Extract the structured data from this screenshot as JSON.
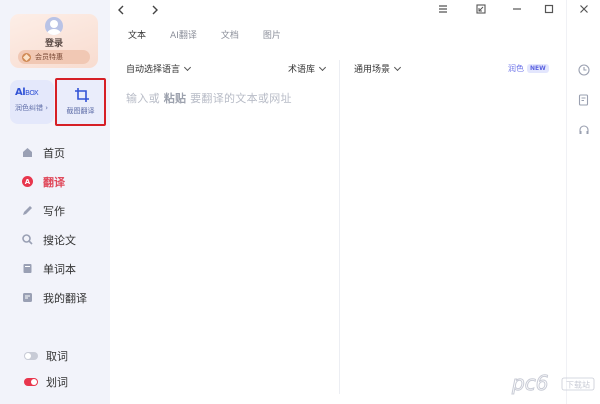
{
  "user": {
    "login_label": "登录",
    "vip_label": "会员特惠"
  },
  "aibox": {
    "title": "Al",
    "title_small": "BOX",
    "subtitle": "润色纠错 ›"
  },
  "screenshot_translate": {
    "label": "截图翻译"
  },
  "nav": [
    {
      "label": "首页",
      "icon": "home-icon",
      "active": false
    },
    {
      "label": "翻译",
      "icon": "translate-icon",
      "active": true
    },
    {
      "label": "写作",
      "icon": "pen-icon",
      "active": false
    },
    {
      "label": "搜论文",
      "icon": "search-icon",
      "active": false
    },
    {
      "label": "单词本",
      "icon": "book-icon",
      "active": false
    },
    {
      "label": "我的翻译",
      "icon": "history-icon",
      "active": false
    }
  ],
  "toggles": {
    "fetch_word": "取词",
    "select_word": "划词"
  },
  "tabs": [
    "文本",
    "AI翻译",
    "文档",
    "图片"
  ],
  "source": {
    "language": "自动选择语言",
    "glossary": "术语库",
    "placeholder_pre": "输入或 ",
    "placeholder_bold": "粘贴",
    "placeholder_post": " 要翻译的文本或网址"
  },
  "target": {
    "scene": "通用场景",
    "polish": "润色",
    "new_badge": "NEW"
  },
  "watermark": {
    "text": "pc6",
    "tag": "下载站"
  },
  "colors": {
    "accent_red": "#e04a5c",
    "accent_blue": "#3354d6",
    "highlight_box": "#d61f26"
  }
}
